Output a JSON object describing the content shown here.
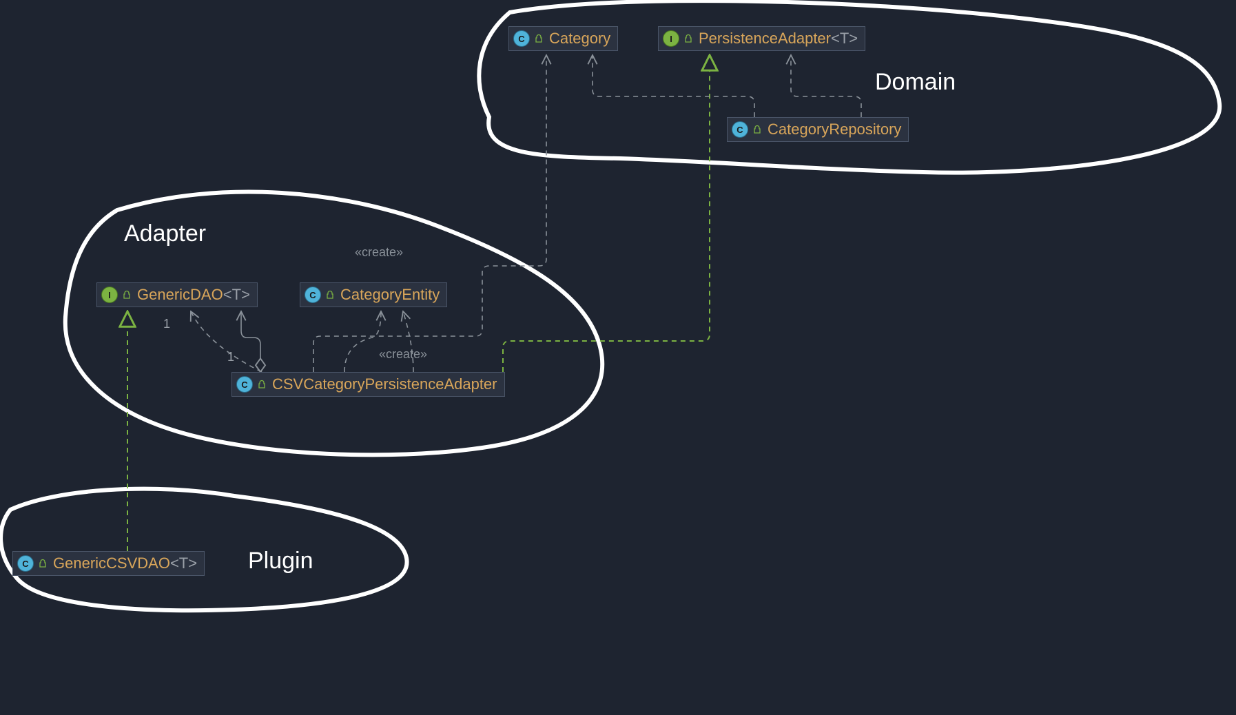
{
  "regions": {
    "domain": "Domain",
    "adapter": "Adapter",
    "plugin": "Plugin"
  },
  "nodes": {
    "category": {
      "kind": "C",
      "name": "Category",
      "generic": ""
    },
    "persistAdapter": {
      "kind": "I",
      "name": "PersistenceAdapter",
      "generic": "<T>"
    },
    "categoryRepo": {
      "kind": "C",
      "name": "CategoryRepository",
      "generic": ""
    },
    "genericDao": {
      "kind": "I",
      "name": "GenericDAO",
      "generic": "<T>"
    },
    "categoryEntity": {
      "kind": "C",
      "name": "CategoryEntity",
      "generic": ""
    },
    "csvCatAdapter": {
      "kind": "C",
      "name": "CSVCategoryPersistenceAdapter",
      "generic": ""
    },
    "genericCsvDao": {
      "kind": "C",
      "name": "GenericCSVDAO",
      "generic": "<T>"
    }
  },
  "edgeLabels": {
    "create1": "«create»",
    "create2": "«create»"
  },
  "multiplicities": {
    "m1": "1",
    "m2": "1"
  },
  "chart_data": {
    "type": "uml_class_diagram",
    "regions": [
      {
        "name": "Domain",
        "contains": [
          "Category",
          "PersistenceAdapter<T>",
          "CategoryRepository"
        ]
      },
      {
        "name": "Adapter",
        "contains": [
          "GenericDAO<T>",
          "CategoryEntity",
          "CSVCategoryPersistenceAdapter"
        ]
      },
      {
        "name": "Plugin",
        "contains": [
          "GenericCSVDAO<T>"
        ]
      }
    ],
    "classes": [
      {
        "name": "Category",
        "stereotype": "class"
      },
      {
        "name": "PersistenceAdapter<T>",
        "stereotype": "interface"
      },
      {
        "name": "CategoryRepository",
        "stereotype": "class"
      },
      {
        "name": "GenericDAO<T>",
        "stereotype": "interface"
      },
      {
        "name": "CategoryEntity",
        "stereotype": "class"
      },
      {
        "name": "CSVCategoryPersistenceAdapter",
        "stereotype": "class"
      },
      {
        "name": "GenericCSVDAO<T>",
        "stereotype": "class"
      }
    ],
    "relationships": [
      {
        "from": "GenericCSVDAO<T>",
        "to": "GenericDAO<T>",
        "type": "realization"
      },
      {
        "from": "CSVCategoryPersistenceAdapter",
        "to": "GenericDAO<T>",
        "type": "aggregation",
        "multiplicity_to": "1"
      },
      {
        "from": "CSVCategoryPersistenceAdapter",
        "to": "GenericDAO<T>",
        "type": "dependency",
        "multiplicity_to": "1"
      },
      {
        "from": "CSVCategoryPersistenceAdapter",
        "to": "CategoryEntity",
        "type": "dependency",
        "label": "«create»"
      },
      {
        "from": "CSVCategoryPersistenceAdapter",
        "to": "CategoryEntity",
        "type": "dependency"
      },
      {
        "from": "CSVCategoryPersistenceAdapter",
        "to": "Category",
        "type": "dependency",
        "label": "«create»"
      },
      {
        "from": "CSVCategoryPersistenceAdapter",
        "to": "PersistenceAdapter<T>",
        "type": "realization"
      },
      {
        "from": "CategoryRepository",
        "to": "Category",
        "type": "dependency"
      },
      {
        "from": "CategoryRepository",
        "to": "PersistenceAdapter<T>",
        "type": "dependency"
      }
    ]
  }
}
